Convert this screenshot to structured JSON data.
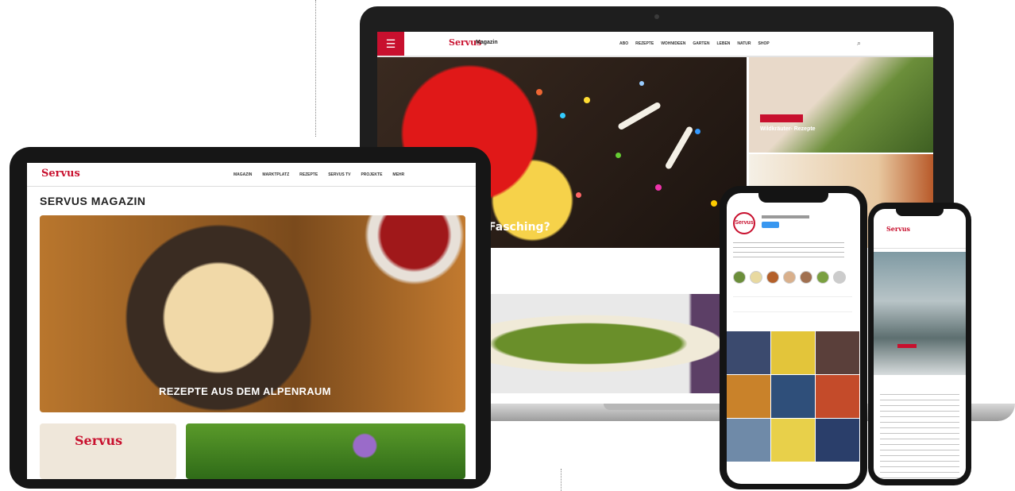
{
  "laptop": {
    "logo": "Servus",
    "logo_sub": "Magazin",
    "nav_links": [
      "ABO",
      "REZEPTE",
      "WOHNIDEEN",
      "GARTEN",
      "LEBEN",
      "NATUR",
      "SHOP"
    ],
    "hero_title": "Fasching?",
    "side_title": "Wildkräuter- Rezepte"
  },
  "tablet": {
    "logo": "Servus",
    "nav_links": [
      "MAGAZIN",
      "MARKTPLATZ",
      "REZEPTE",
      "SERVUS TV",
      "PROJEKTE",
      "MEHR"
    ],
    "page_title": "SERVUS MAGAZIN",
    "hero_title": "REZEPTE AUS DEM ALPENRAUM",
    "card_logo": "Servus"
  },
  "phone_instagram": {
    "avatar": "Servus"
  },
  "phone_web": {
    "logo": "Servus"
  },
  "colors": {
    "brand_red": "#c8102e",
    "device_frame": "#161616"
  }
}
